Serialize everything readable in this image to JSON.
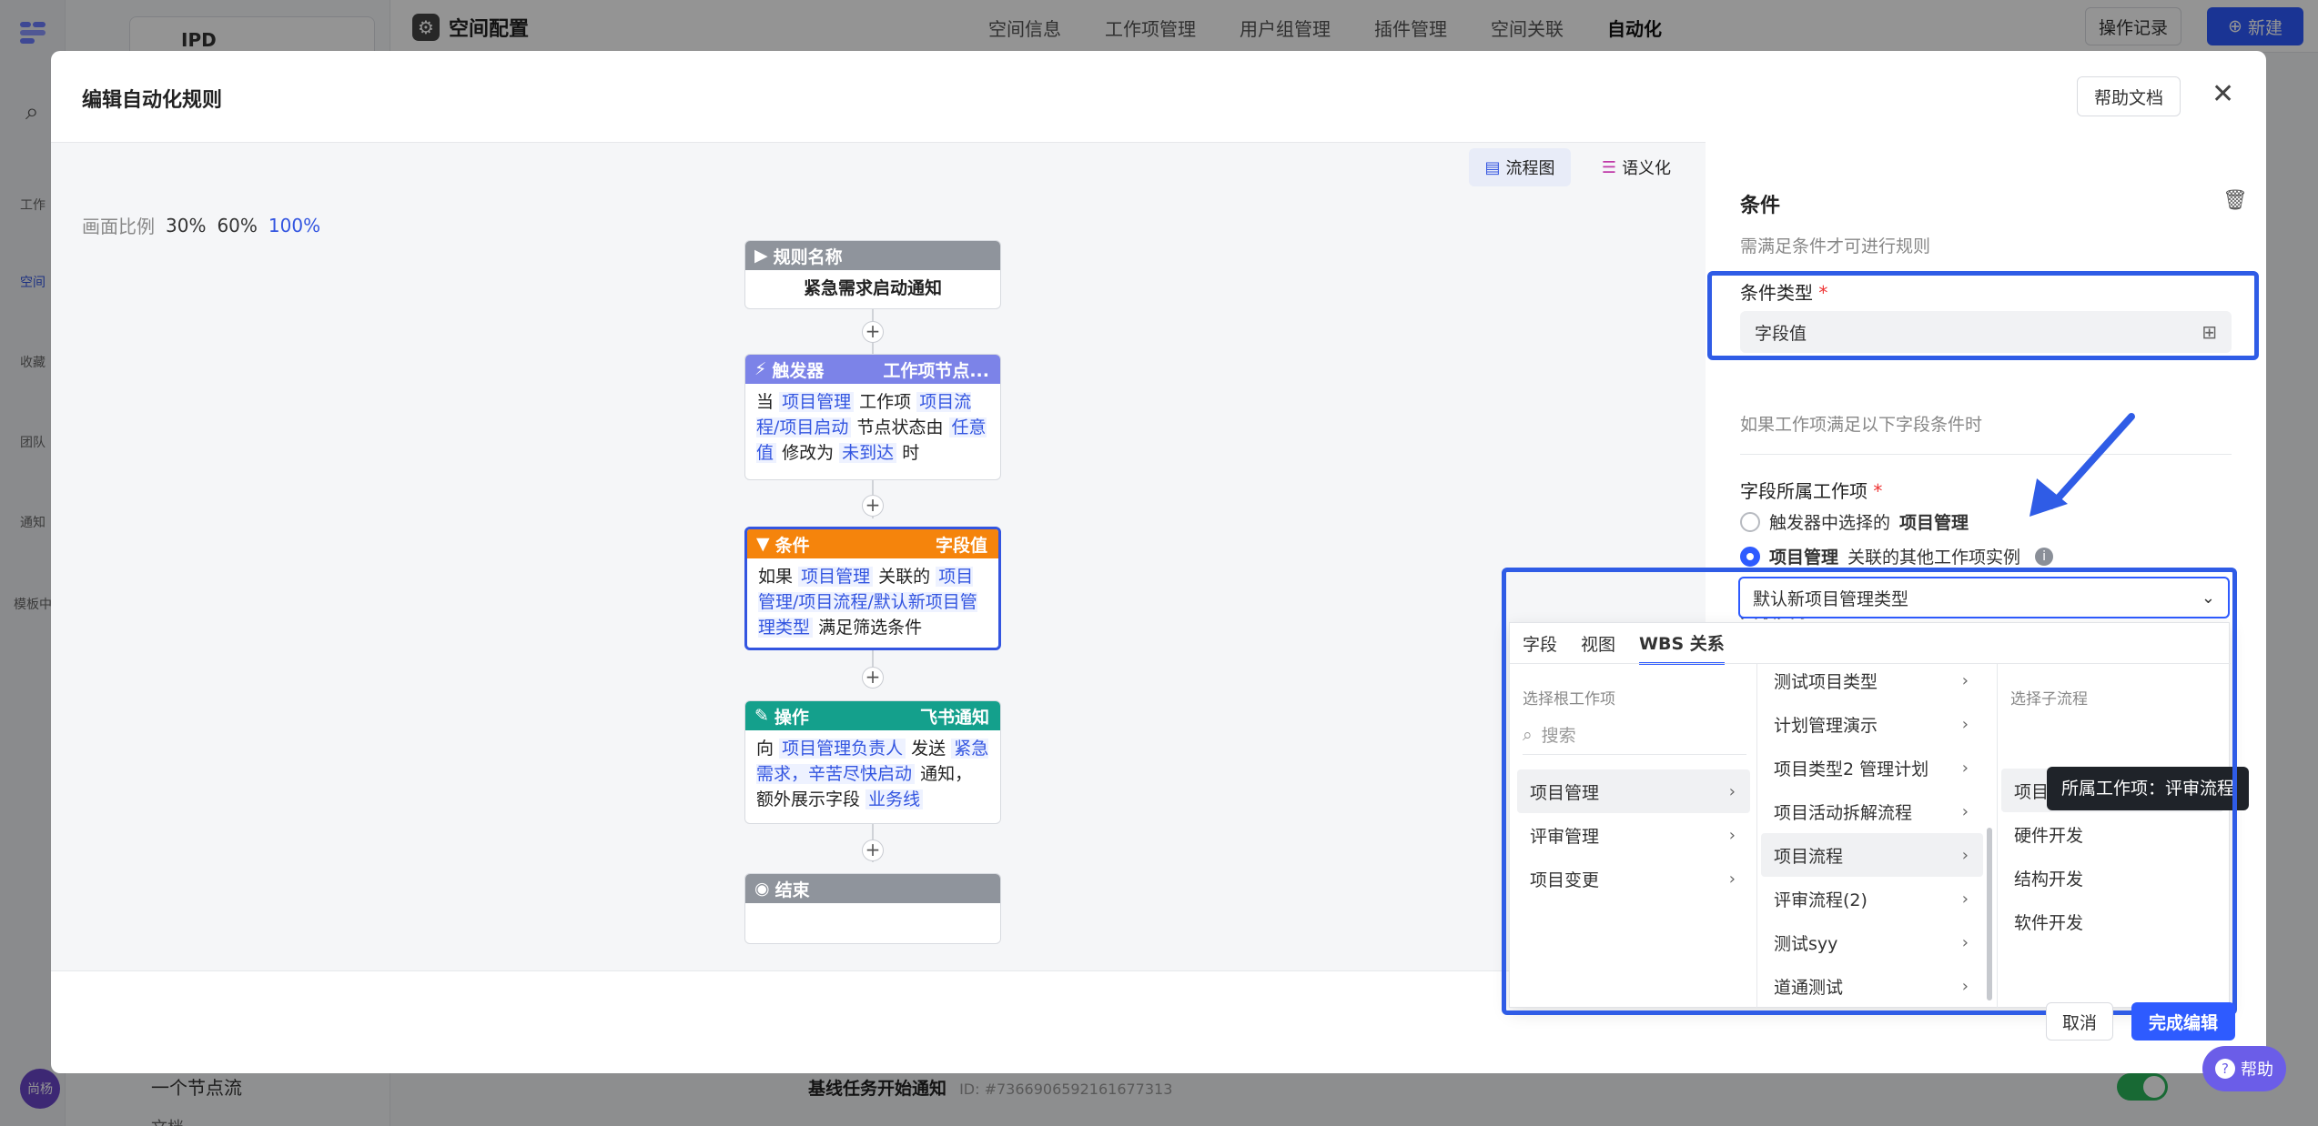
{
  "app": {
    "project_name": "IPD",
    "page_title": "空间配置",
    "nav": [
      "空间信息",
      "工作项管理",
      "用户组管理",
      "插件管理",
      "空间关联",
      "自动化"
    ],
    "ops_log": "操作记录",
    "new_btn": "新建",
    "sidebar": [
      "工作",
      "空间",
      "收藏",
      "团队",
      "通知",
      "模板中"
    ],
    "sub_item": "一个节点流",
    "sub_item2": "文档",
    "avatar": "尚杨",
    "bottom_rule": "基线任务开始通知",
    "bottom_id": "ID: #7366906592161677313",
    "help": "帮助"
  },
  "modal": {
    "title": "编辑自动化规则",
    "help_doc": "帮助文档",
    "view_flow": "流程图",
    "view_semantic": "语义化",
    "cancel": "取消",
    "done": "完成编辑"
  },
  "canvas": {
    "zoom_label": "画面比例",
    "zoom": [
      "30%",
      "60%",
      "100%"
    ]
  },
  "nodes": {
    "name": {
      "header": "规则名称",
      "body": "紧急需求启动通知"
    },
    "trigger": {
      "header": "触发器",
      "tag": "工作项节点...",
      "t1": "当",
      "k1": "项目管理",
      "t2": "工作项",
      "k2": "项目流程/项目启动",
      "t3": "节点状态由",
      "k3": "任意值",
      "t4": "修改为",
      "k4": "未到达",
      "t5": "时"
    },
    "condition": {
      "header": "条件",
      "tag": "字段值",
      "t1": "如果",
      "k1": "项目管理",
      "t2": "关联的",
      "k2": "项目管理/项目流程/默认新项目管理类型",
      "t3": "满足筛选条件"
    },
    "action": {
      "header": "操作",
      "tag": "飞书通知",
      "t1": "向",
      "k1": "项目管理负责人",
      "t2": "发送",
      "k2": "紧急需求，辛苦尽快启动",
      "t3": "通知，额外展示字段",
      "k3": "业务线"
    },
    "end": {
      "header": "结束"
    }
  },
  "panel": {
    "title": "条件",
    "desc": "需满足条件才可进行规则",
    "cond_type_label": "条件类型",
    "cond_type_value": "字段值",
    "cond_hint": "如果工作项满足以下字段条件时",
    "owner_label": "字段所属工作项",
    "radio1_a": "触发器中选择的",
    "radio1_b": "项目管理",
    "radio2_a": "项目管理",
    "radio2_b": "关联的其他工作项实例",
    "relation_label": "关联关系",
    "relation_value": "默认新项目管理类型"
  },
  "dropdown": {
    "tabs": [
      "字段",
      "视图",
      "WBS 关系"
    ],
    "col1_title": "选择根工作项",
    "search_placeholder": "搜索",
    "col1": [
      "项目管理",
      "评审管理",
      "项目变更"
    ],
    "col2": [
      "测试项目类型",
      "计划管理演示",
      "项目类型2 管理计划",
      "项目活动拆解流程",
      "项目流程",
      "评审流程(2)",
      "测试syy",
      "道通测试"
    ],
    "col3_title": "选择子流程",
    "col3": [
      "项目评审",
      "硬件开发",
      "结构开发",
      "软件开发"
    ],
    "tooltip": "所属工作项：评审流程"
  },
  "colors": {
    "accent": "#2e5bff",
    "trigger": "#7c83e8",
    "condition": "#f5840c",
    "action": "#14a08c",
    "grey": "#8f949c"
  }
}
